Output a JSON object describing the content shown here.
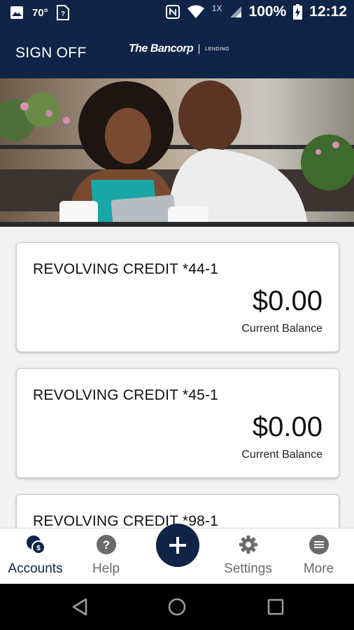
{
  "status_bar": {
    "temperature": "70°",
    "secondary_signal": "1X",
    "battery": "100%",
    "time": "12:12",
    "icons": [
      "image-icon",
      "sim-card-icon",
      "nfc-icon",
      "wifi-icon",
      "cell-signal-icon",
      "battery-charging-icon"
    ]
  },
  "header": {
    "sign_off_label": "SIGN OFF",
    "logo_text": "The Bancorp",
    "logo_sub": "LENDING"
  },
  "hero": {
    "image_icon": "hero-photo"
  },
  "accounts": [
    {
      "name": "REVOLVING CREDIT *44-1",
      "balance": "$0.00",
      "balance_label": "Current Balance"
    },
    {
      "name": "REVOLVING CREDIT *45-1",
      "balance": "$0.00",
      "balance_label": "Current Balance"
    },
    {
      "name": "REVOLVING CREDIT *98-1",
      "balance": "",
      "balance_label": ""
    }
  ],
  "bottom_nav": {
    "accounts": "Accounts",
    "help": "Help",
    "add_icon": "plus-icon",
    "settings": "Settings",
    "more": "More"
  },
  "colors": {
    "brand_navy": "#0f2447",
    "inactive_gray": "#6b6b6b",
    "background": "#f2f2f2"
  }
}
